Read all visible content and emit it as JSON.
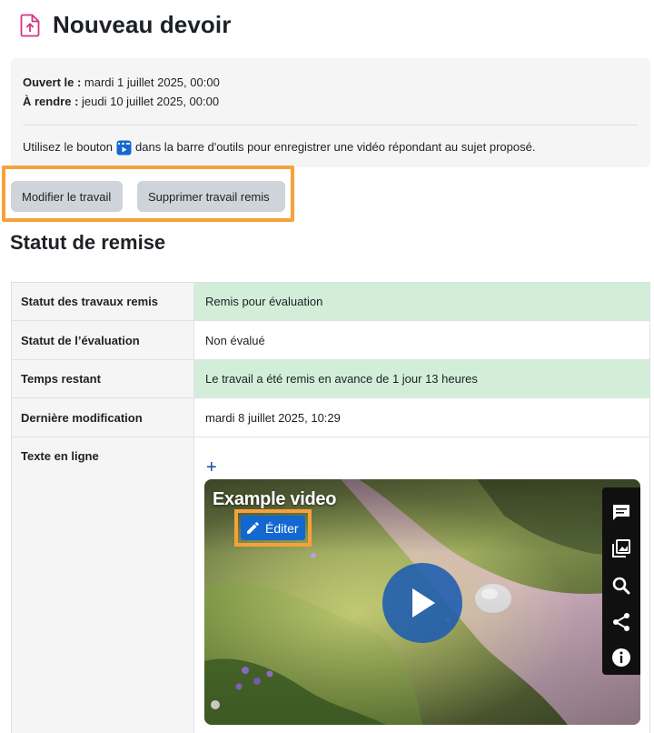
{
  "page": {
    "title": "Nouveau devoir",
    "icon": "assignment-upload-icon"
  },
  "dates": {
    "opened_label": "Ouvert le :",
    "opened_value": "mardi 1 juillet 2025, 00:00",
    "due_label": "À rendre :",
    "due_value": "jeudi 10 juillet 2025, 00:00"
  },
  "instruction": {
    "before": "Utilisez le bouton",
    "icon": "record-video-icon",
    "after": "dans la barre d'outils pour enregistrer une vidéo répondant au sujet proposé."
  },
  "actions": {
    "modify_label": "Modifier le travail",
    "delete_label": "Supprimer travail remis"
  },
  "submission": {
    "section_title": "Statut de remise",
    "rows": [
      {
        "label": "Statut des travaux remis",
        "value": "Remis pour évaluation"
      },
      {
        "label": "Statut de l’évaluation",
        "value": "Non évalué"
      },
      {
        "label": "Temps restant",
        "value": "Le travail a été remis en avance de 1 jour 13 heures"
      },
      {
        "label": "Dernière modification",
        "value": "mardi 8 juillet 2025, 10:29"
      },
      {
        "label": "Texte en ligne",
        "value": ""
      }
    ]
  },
  "online_text": {
    "expand_symbol": "+",
    "video": {
      "title": "Example video",
      "edit_label": "Éditer",
      "side_icons": [
        "comments-icon",
        "image-gallery-icon",
        "search-icon",
        "share-icon",
        "info-icon"
      ]
    }
  },
  "colors": {
    "accent_blue": "#1268cf",
    "highlight_orange": "#f7a13a",
    "status_green": "#d2eed8",
    "button_gray": "#ced4da",
    "title_icon_pink": "#d63384"
  }
}
